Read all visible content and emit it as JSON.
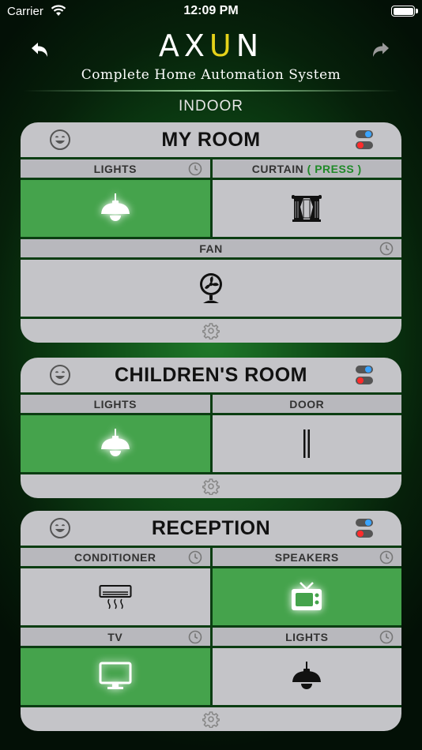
{
  "statusbar": {
    "carrier": "Carrier",
    "time": "12:09 PM"
  },
  "header": {
    "logo_left": "AX",
    "logo_accent": "U",
    "logo_right": "N",
    "subtitle": "Complete Home Automation System"
  },
  "section": {
    "title": "INDOOR"
  },
  "colors": {
    "active_tile": "#45a34c",
    "logo_accent": "#e5d21a",
    "press_text": "#1f8a28",
    "panel": "#c4c4c8"
  },
  "rooms": [
    {
      "title": "MY ROOM",
      "devices": [
        {
          "label": "LIGHTS",
          "icon": "ceiling-lamp-icon",
          "on": true
        },
        {
          "label": "CURTAIN",
          "label_extra": "( PRESS )",
          "icon": "curtain-icon",
          "on": false
        },
        {
          "label": "FAN",
          "icon": "fan-icon",
          "on": false
        }
      ]
    },
    {
      "title": "CHILDREN'S ROOM",
      "devices": [
        {
          "label": "LIGHTS",
          "icon": "ceiling-lamp-icon",
          "on": true
        },
        {
          "label": "DOOR",
          "icon": "door-icon",
          "on": false
        }
      ]
    },
    {
      "title": "RECEPTION",
      "devices": [
        {
          "label": "CONDITIONER",
          "icon": "air-conditioner-icon",
          "on": false
        },
        {
          "label": "SPEAKERS",
          "icon": "speaker-icon",
          "on": true
        },
        {
          "label": "TV",
          "icon": "tv-icon",
          "on": true
        },
        {
          "label": "LIGHTS",
          "icon": "ceiling-lamp-icon",
          "on": false
        }
      ]
    }
  ]
}
